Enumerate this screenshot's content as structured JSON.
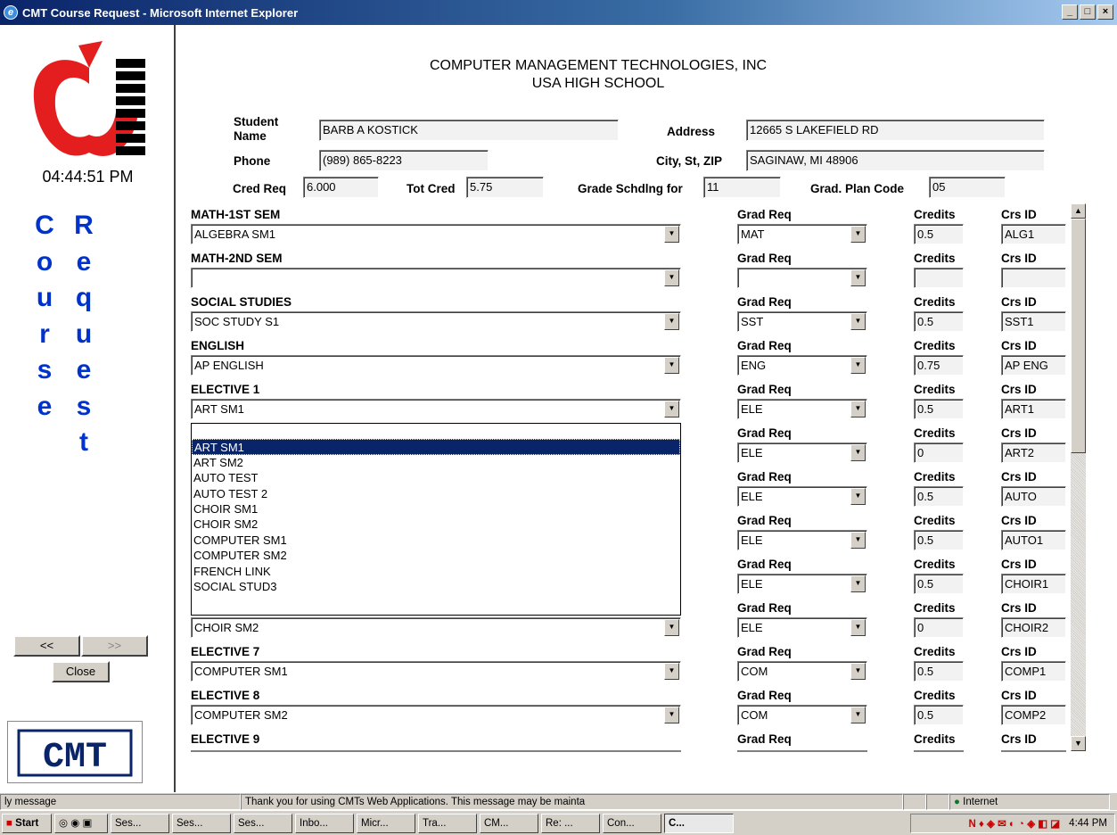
{
  "window": {
    "title": "CMT Course Request - Microsoft Internet Explorer"
  },
  "left": {
    "clock": "04:44:51 PM",
    "vertical_col1": [
      "C",
      "o",
      "u",
      "r",
      "s",
      "e"
    ],
    "vertical_col2": [
      "R",
      "e",
      "q",
      "u",
      "e",
      "s",
      "t"
    ],
    "prev_label": "<<",
    "next_label": ">>",
    "close_label": "Close",
    "logo_text": "CMT"
  },
  "header": {
    "line1": "COMPUTER MANAGEMENT TECHNOLOGIES, INC",
    "line2": "USA HIGH SCHOOL"
  },
  "student": {
    "name_label": "Student Name",
    "name": "BARB A KOSTICK",
    "address_label": "Address",
    "address": "12665 S LAKEFIELD RD",
    "phone_label": "Phone",
    "phone": "(989) 865-8223",
    "city_label": "City, St, ZIP",
    "city": "SAGINAW, MI  48906",
    "cred_req_label": "Cred Req",
    "cred_req": "6.000",
    "tot_cred_label": "Tot Cred",
    "tot_cred": "5.75",
    "grade_label": "Grade Schdlng for",
    "grade": "11",
    "plan_label": "Grad. Plan Code",
    "plan": "05"
  },
  "col_labels": {
    "grad_req": "Grad Req",
    "credits": "Credits",
    "crs_id": "Crs ID"
  },
  "rows": [
    {
      "label": "MATH-1ST SEM",
      "course": "ALGEBRA SM1",
      "grad_req": "MAT",
      "credits": "0.5",
      "crs_id": "ALG1"
    },
    {
      "label": "MATH-2ND SEM",
      "course": "",
      "grad_req": "",
      "credits": "",
      "crs_id": ""
    },
    {
      "label": "SOCIAL STUDIES",
      "course": "SOC STUDY S1",
      "grad_req": "SST",
      "credits": "0.5",
      "crs_id": "SST1"
    },
    {
      "label": "ENGLISH",
      "course": "AP ENGLISH",
      "grad_req": "ENG",
      "credits": "0.75",
      "crs_id": "AP ENG"
    },
    {
      "label": "ELECTIVE 1",
      "course": "ART SM1",
      "grad_req": "ELE",
      "credits": "0.5",
      "crs_id": "ART1"
    },
    {
      "label": "",
      "course": "",
      "grad_req": "ELE",
      "credits": "0",
      "crs_id": "ART2"
    },
    {
      "label": "",
      "course": "",
      "grad_req": "ELE",
      "credits": "0.5",
      "crs_id": "AUTO"
    },
    {
      "label": "",
      "course": "",
      "grad_req": "ELE",
      "credits": "0.5",
      "crs_id": "AUTO1"
    },
    {
      "label": "",
      "course": "",
      "grad_req": "ELE",
      "credits": "0.5",
      "crs_id": "CHOIR1"
    },
    {
      "label": "",
      "course": "CHOIR SM2",
      "grad_req": "ELE",
      "credits": "0",
      "crs_id": "CHOIR2"
    },
    {
      "label": "ELECTIVE 7",
      "course": "COMPUTER SM1",
      "grad_req": "COM",
      "credits": "0.5",
      "crs_id": "COMP1"
    },
    {
      "label": "ELECTIVE 8",
      "course": "COMPUTER SM2",
      "grad_req": "COM",
      "credits": "0.5",
      "crs_id": "COMP2"
    },
    {
      "label": "ELECTIVE 9",
      "course": "",
      "grad_req": "",
      "credits": "",
      "crs_id": ""
    }
  ],
  "dropdown_options": [
    "",
    "ART SM1",
    "ART SM2",
    "AUTO TEST",
    "AUTO TEST 2",
    "CHOIR SM1",
    "CHOIR SM2",
    "COMPUTER SM1",
    "COMPUTER SM2",
    "FRENCH LINK",
    "SOCIAL STUD3"
  ],
  "dropdown_selected": "ART SM1",
  "status": {
    "left": "ly message",
    "message": "Thank you for using CMTs Web Applications.  This message may be mainta",
    "zone": "Internet"
  },
  "taskbar": {
    "start": "Start",
    "tasks": [
      "Ses...",
      "Ses...",
      "Ses...",
      "Inbo...",
      "Micr...",
      "Tra...",
      "CM...",
      "Re: ...",
      "Con...",
      "C..."
    ],
    "time": "4:44 PM"
  }
}
